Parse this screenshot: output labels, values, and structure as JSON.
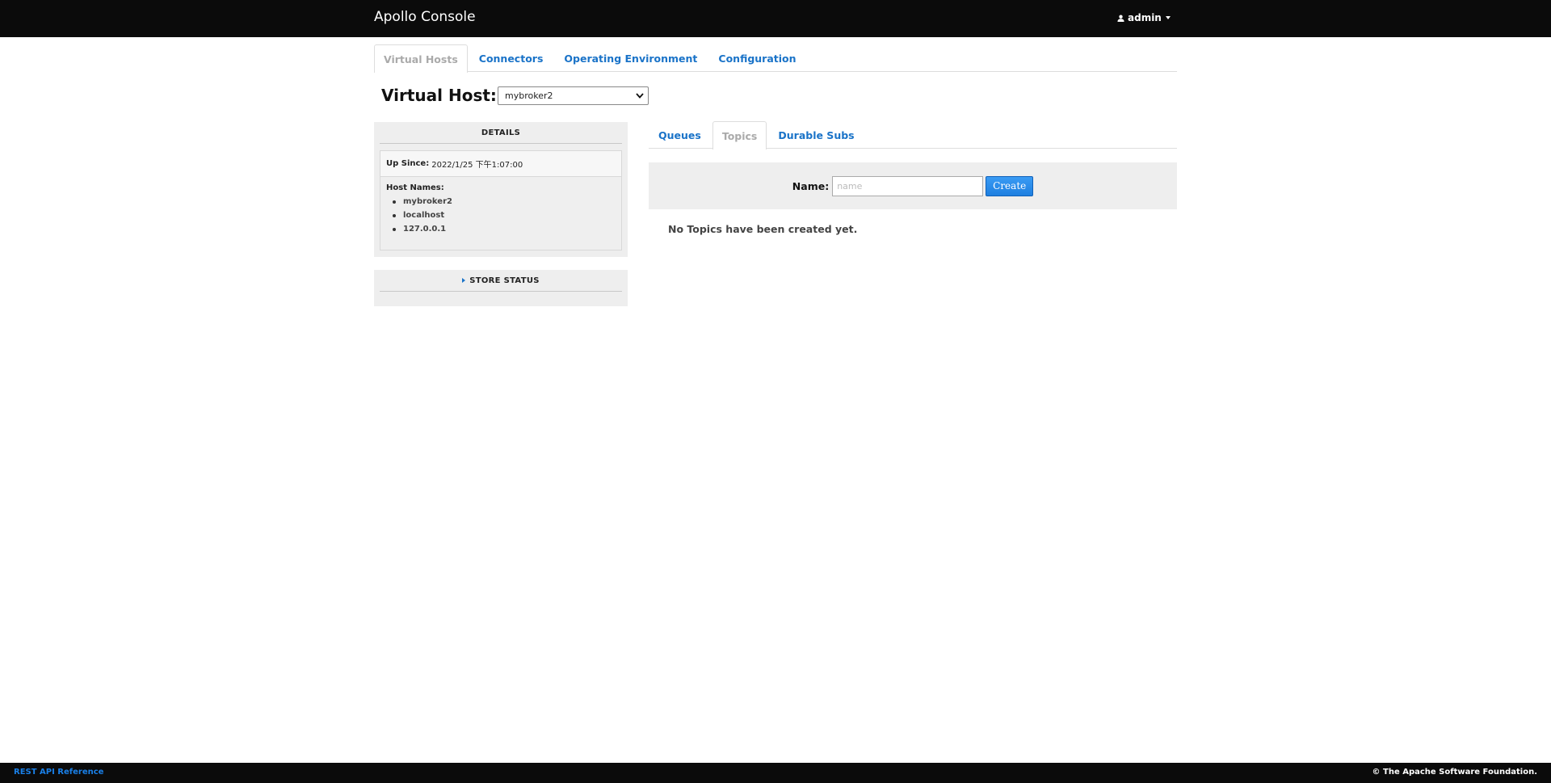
{
  "header": {
    "brand": "Apollo Console",
    "user": "admin"
  },
  "main_tabs": [
    {
      "label": "Virtual Hosts",
      "active": true
    },
    {
      "label": "Connectors",
      "active": false
    },
    {
      "label": "Operating Environment",
      "active": false
    },
    {
      "label": "Configuration",
      "active": false
    }
  ],
  "virtual_host": {
    "label": "Virtual Host:",
    "selected": "mybroker2"
  },
  "details": {
    "title": "DETAILS",
    "up_since_label": "Up Since:",
    "up_since_value": "2022/1/25 下午1:07:00",
    "host_names_label": "Host Names:",
    "host_names": [
      "mybroker2",
      "localhost",
      "127.0.0.1"
    ]
  },
  "store_status": {
    "title": "STORE STATUS"
  },
  "sub_tabs": [
    {
      "label": "Queues",
      "active": false
    },
    {
      "label": "Topics",
      "active": true
    },
    {
      "label": "Durable Subs",
      "active": false
    }
  ],
  "create_form": {
    "label": "Name:",
    "placeholder": "name",
    "value": "",
    "button": "Create"
  },
  "empty_message": "No Topics have been created yet.",
  "footer": {
    "link": "REST API Reference",
    "copyright": "© The Apache Software Foundation."
  },
  "colors": {
    "navbar": "#0b0b0b",
    "link": "#1a73c8",
    "panel": "#eeeeee",
    "button": "#1e7fe0"
  }
}
